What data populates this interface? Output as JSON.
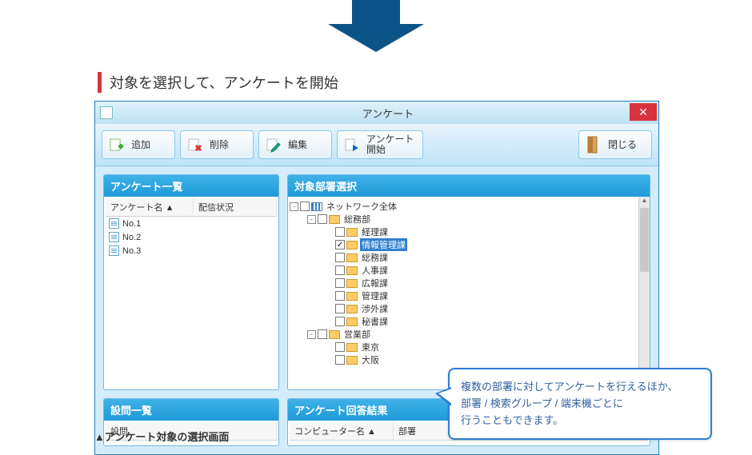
{
  "section_title": "対象を選択して、アンケートを開始",
  "window": {
    "title": "アンケート",
    "close_glyph": "✕"
  },
  "toolbar": {
    "add": "追加",
    "delete": "削除",
    "edit": "編集",
    "start_line1": "アンケート",
    "start_line2": "開始",
    "close": "閉じる"
  },
  "panels": {
    "survey_list": {
      "header": "アンケート一覧",
      "col_name": "アンケート名",
      "col_status": "配信状況",
      "items": [
        "No.1",
        "No.2",
        "No.3"
      ]
    },
    "question_list": {
      "header": "設問一覧",
      "col_question": "設問"
    },
    "dept_select": {
      "header": "対象部署選択",
      "nodes": [
        {
          "indent": 0,
          "toggle": "-",
          "label": "ネットワーク全体",
          "icon": "net",
          "checked": false
        },
        {
          "indent": 1,
          "toggle": "-",
          "label": "総務部",
          "icon": "dept",
          "checked": false
        },
        {
          "indent": 2,
          "toggle": "",
          "label": "経理課",
          "icon": "dept",
          "checked": false
        },
        {
          "indent": 2,
          "toggle": "",
          "label": "情報管理課",
          "icon": "dept",
          "checked": true,
          "selected": true
        },
        {
          "indent": 2,
          "toggle": "",
          "label": "総務課",
          "icon": "dept",
          "checked": false
        },
        {
          "indent": 2,
          "toggle": "",
          "label": "人事課",
          "icon": "dept",
          "checked": false
        },
        {
          "indent": 2,
          "toggle": "",
          "label": "広報課",
          "icon": "dept",
          "checked": false
        },
        {
          "indent": 2,
          "toggle": "",
          "label": "管理課",
          "icon": "dept",
          "checked": false
        },
        {
          "indent": 2,
          "toggle": "",
          "label": "渉外課",
          "icon": "dept",
          "checked": false
        },
        {
          "indent": 2,
          "toggle": "",
          "label": "秘書課",
          "icon": "dept",
          "checked": false
        },
        {
          "indent": 1,
          "toggle": "-",
          "label": "営業部",
          "icon": "dept",
          "checked": false
        },
        {
          "indent": 2,
          "toggle": "",
          "label": "東京",
          "icon": "dept",
          "checked": false
        },
        {
          "indent": 2,
          "toggle": "",
          "label": "大阪",
          "icon": "dept",
          "checked": false
        }
      ]
    },
    "result": {
      "header": "アンケート回答結果",
      "col_computer": "コンピューター名",
      "col_dept": "部署"
    }
  },
  "callout": {
    "line1": "複数の部署に対してアンケートを行えるほか、",
    "line2": "部署 / 検索グループ / 端末機ごとに",
    "line3": "行うこともできます。"
  },
  "caption": "▲アンケート対象の選択画面"
}
